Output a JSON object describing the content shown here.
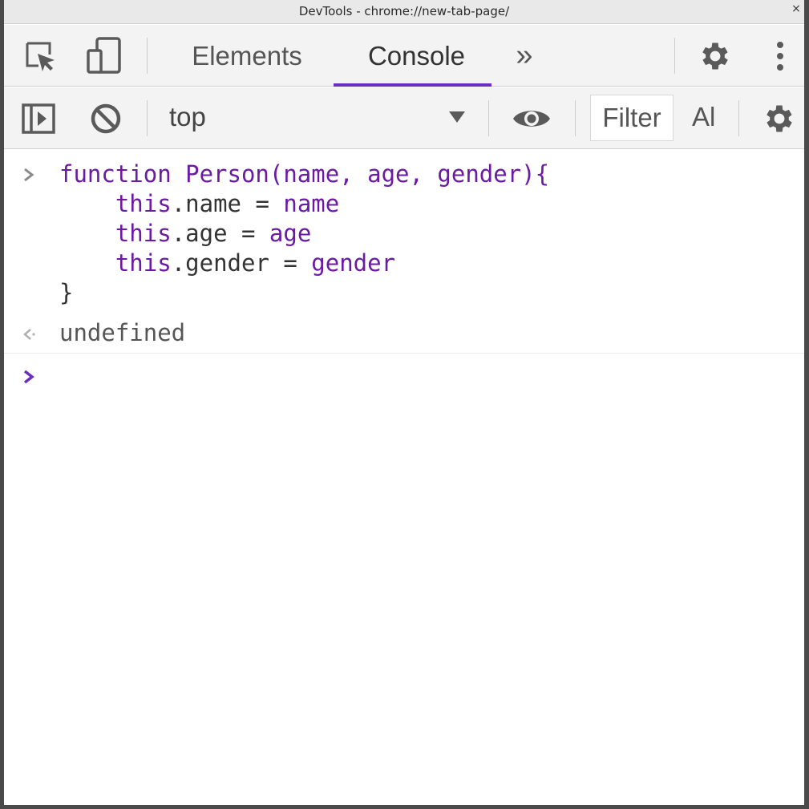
{
  "window": {
    "title": "DevTools - chrome://new-tab-page/",
    "close_glyph": "×"
  },
  "main_toolbar": {
    "tabs": [
      {
        "label": "Elements",
        "active": false
      },
      {
        "label": "Console",
        "active": true
      }
    ],
    "more_tabs_glyph": "»",
    "icons": [
      "inspect-element-icon",
      "device-toolbar-icon",
      "gear-icon",
      "more-vertical-icon"
    ]
  },
  "console_toolbar": {
    "context": "top",
    "filter_placeholder": "Filter",
    "levels": "Al",
    "icons": [
      "sidebar-toggle-icon",
      "clear-console-icon",
      "chevron-down-icon",
      "eye-icon",
      "gear-icon"
    ]
  },
  "console": {
    "input_lines": [
      [
        {
          "t": "function Person(name, age, gender){",
          "c": "kw"
        }
      ],
      [
        {
          "t": "    ",
          "c": ""
        },
        {
          "t": "this",
          "c": "kw"
        },
        {
          "t": ".name = ",
          "c": ""
        },
        {
          "t": "name",
          "c": "kw"
        }
      ],
      [
        {
          "t": "    ",
          "c": ""
        },
        {
          "t": "this",
          "c": "kw"
        },
        {
          "t": ".age = ",
          "c": ""
        },
        {
          "t": "age",
          "c": "kw"
        }
      ],
      [
        {
          "t": "    ",
          "c": ""
        },
        {
          "t": "this",
          "c": "kw"
        },
        {
          "t": ".gender = ",
          "c": ""
        },
        {
          "t": "gender",
          "c": "kw"
        }
      ],
      [
        {
          "t": "}",
          "c": ""
        }
      ]
    ],
    "result": "undefined"
  },
  "colors": {
    "accent": "#6a2fc0",
    "keyword": "#6b1aa3",
    "toolbar_bg": "#f3f3f3",
    "icon": "#555555"
  }
}
